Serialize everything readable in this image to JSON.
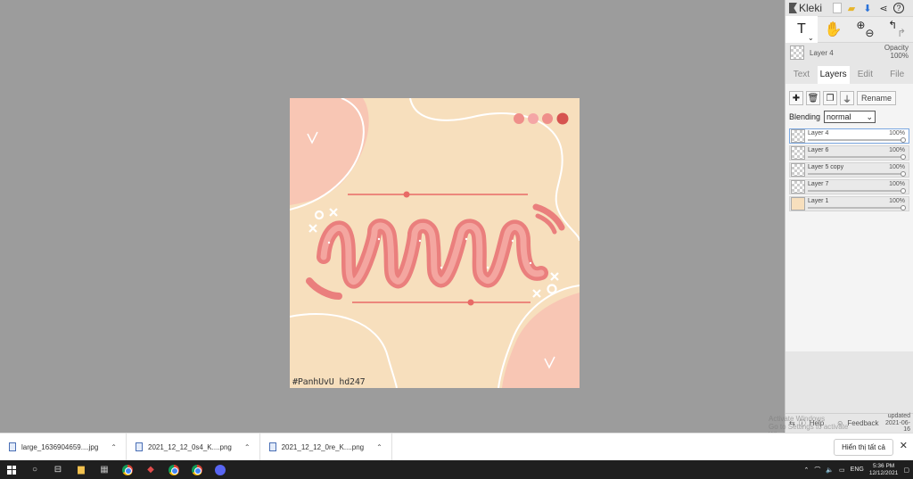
{
  "app": {
    "name": "Kleki",
    "updated_label": "updated",
    "updated_date": "2021-06-16"
  },
  "toolbar": {
    "text_tool": "T",
    "hand_tool": "✋",
    "zoom_in": "⊕",
    "zoom_out": "⊖",
    "undo": "↰",
    "redo": "↱"
  },
  "current_layer": {
    "name": "Layer 4",
    "opacity_label": "Opacity",
    "opacity_value": "100%"
  },
  "tabs": [
    "Text",
    "Layers",
    "Edit",
    "File"
  ],
  "active_tab": "Layers",
  "layers_panel": {
    "rename_label": "Rename",
    "blending_label": "Blending",
    "blending_value": "normal",
    "layers": [
      {
        "name": "Layer 4",
        "opacity": "100%",
        "selected": true
      },
      {
        "name": "Layer 6",
        "opacity": "100%",
        "selected": false
      },
      {
        "name": "Layer 5 copy",
        "opacity": "100%",
        "selected": false
      },
      {
        "name": "Layer 7",
        "opacity": "100%",
        "selected": false
      },
      {
        "name": "Layer 1",
        "opacity": "100%",
        "selected": false
      }
    ]
  },
  "footer": {
    "help": "Help",
    "feedback": "Feedback"
  },
  "overlay": {
    "activate_line1": "Activate Windows",
    "activate_line2": "Go to Settings to activate Windows."
  },
  "artwork": {
    "watermark": "#PanhUvU    hd247",
    "colors": {
      "background": "#f7dfbd",
      "blob": "#f8c6b4",
      "ribbon": "#ea7f7d",
      "ribbon_light": "#f4a6a0",
      "line": "#e86a66",
      "dot4": "#d6534f"
    }
  },
  "downloads": {
    "items": [
      "large_1636904659....jpg",
      "2021_12_12_0s4_K....png",
      "2021_12_12_0re_K....png"
    ],
    "show_all": "Hiển thị tất cả"
  },
  "taskbar": {
    "lang": "ENG",
    "time": "5:36 PM",
    "date": "12/12/2021"
  }
}
